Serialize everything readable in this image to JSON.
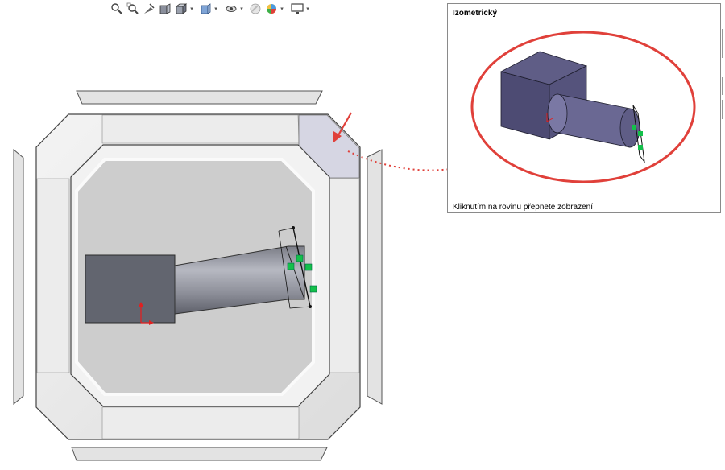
{
  "toolbar": {
    "buttons": [
      {
        "icon": "zoom-to-fit-icon"
      },
      {
        "icon": "zoom-to-area-icon"
      },
      {
        "icon": "previous-view-icon"
      },
      {
        "icon": "section-view-icon"
      },
      {
        "icon": "view-orientation-icon"
      },
      {
        "icon": "display-style-icon"
      },
      {
        "icon": "hide-show-items-icon"
      },
      {
        "icon": "edit-appearance-icon"
      },
      {
        "icon": "apply-scene-icon"
      },
      {
        "icon": "view-settings-icon"
      }
    ]
  },
  "tooltip": {
    "title": "Izometrický",
    "caption": "Kliknutím na rovinu přepnete zobrazení"
  },
  "colors": {
    "cube_face": "#e8e8e8",
    "inner_face": "#cdcdcd",
    "highlight_face": "#d6d6e3",
    "part_dark": "#62656f",
    "iso_part": "#5f5d86",
    "annotation_red": "#e0403a",
    "handle_green": "#13c04a"
  }
}
